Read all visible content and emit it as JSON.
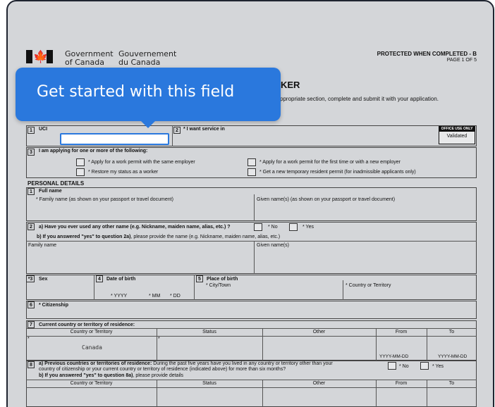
{
  "header": {
    "gov_en_line1": "Government",
    "gov_en_line2": "of Canada",
    "gov_fr_line1": "Gouvernement",
    "gov_fr_line2": "du Canada",
    "protected": "PROTECTED WHEN COMPLETED - B",
    "page": "PAGE 1 OF 5",
    "title_fragment": "KER",
    "intro_fragment": "ppropriate section, complete and submit it with your application."
  },
  "tooltip": {
    "text": "Get started with this field"
  },
  "q1": {
    "num": "1",
    "label": "UCI"
  },
  "q2": {
    "num": "2",
    "label": "* I want service in"
  },
  "office": {
    "header": "OFFICE USE ONLY",
    "value": "Validated"
  },
  "q3": {
    "num": "3",
    "label": "I am applying for one or more of the following:",
    "options": [
      "* Apply for a work permit with the same employer",
      "* Restore my status as a worker",
      "* Apply for a work permit for the first time or with a new employer",
      "* Get a new temporary resident permit (for inadmissible applicants only)"
    ]
  },
  "personal": {
    "heading": "PERSONAL DETAILS",
    "fullname": {
      "num": "1",
      "label": "Full name",
      "family": "* Family name (as shown on your passport or travel document)",
      "given": "Given name(s) (as shown on your passport or travel document)"
    },
    "other_name": {
      "num": "2",
      "question": "a) Have you ever used any other name (e.g. Nickname, maiden name, alias, etc.) ?",
      "no": "* No",
      "yes": "* Yes",
      "followup_bold": "b) If you answered \"yes\" to question 2a)",
      "followup_rest": ", please provide the name (e.g. Nickname, maiden name, alias, etc.)",
      "family": "Family name",
      "given": "Given name(s)"
    },
    "sex": {
      "num": "*3",
      "label": "Sex"
    },
    "dob": {
      "num": "4",
      "label": "Date of birth",
      "yyyy": "* YYYY",
      "mm": "* MM",
      "dd": "* DD"
    },
    "pob": {
      "num": "5",
      "label": "Place of birth",
      "city": "* City/Town",
      "country": "* Country or Territory"
    },
    "citizenship": {
      "num": "6",
      "label": "* Citizenship"
    },
    "residence": {
      "num": "7",
      "label": "Current country or territory of residence:",
      "columns": [
        "Country or Territory",
        "Status",
        "Other",
        "From",
        "To"
      ],
      "value_country": "Canada",
      "star1": "*",
      "star2": "*",
      "from_fmt": "YYYY-MM-DD",
      "to_fmt": "YYYY-MM-DD"
    },
    "previous": {
      "num": "8",
      "line1_bold": "a) Previous countries or territories of residence:",
      "line1_rest": " During the past five years have you lived in any country or territory other than your",
      "line2": "country of citizenship or your current country or territory of residence (indicated above) for more than six months?",
      "line3_bold": "b) If you answered \"yes\" to question 8a)",
      "line3_rest": ", please provide details",
      "no": "* No",
      "yes": "* Yes",
      "columns": [
        "Country or Territory",
        "Status",
        "Other",
        "From",
        "To"
      ]
    }
  }
}
